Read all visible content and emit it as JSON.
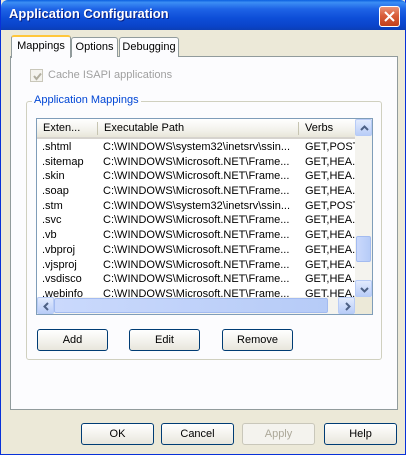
{
  "window": {
    "title": "Application Configuration"
  },
  "tabs": [
    {
      "label": "Mappings",
      "active": true
    },
    {
      "label": "Options",
      "active": false
    },
    {
      "label": "Debugging",
      "active": false
    }
  ],
  "cache_isapi": {
    "label": "Cache ISAPI applications",
    "checked": true,
    "enabled": false
  },
  "group": {
    "label": "Application Mappings"
  },
  "list": {
    "columns": [
      "Exten...",
      "Executable Path",
      "Verbs"
    ],
    "rows": [
      [
        ".shtml",
        "C:\\WINDOWS\\system32\\inetsrv\\ssin...",
        "GET,POST"
      ],
      [
        ".sitemap",
        "C:\\WINDOWS\\Microsoft.NET\\Frame...",
        "GET,HEA..."
      ],
      [
        ".skin",
        "C:\\WINDOWS\\Microsoft.NET\\Frame...",
        "GET,HEA..."
      ],
      [
        ".soap",
        "C:\\WINDOWS\\Microsoft.NET\\Frame...",
        "GET,HEA..."
      ],
      [
        ".stm",
        "C:\\WINDOWS\\system32\\inetsrv\\ssin...",
        "GET,POST"
      ],
      [
        ".svc",
        "C:\\WINDOWS\\Microsoft.NET\\Frame...",
        "GET,HEA..."
      ],
      [
        ".vb",
        "C:\\WINDOWS\\Microsoft.NET\\Frame...",
        "GET,HEA..."
      ],
      [
        ".vbproj",
        "C:\\WINDOWS\\Microsoft.NET\\Frame...",
        "GET,HEA..."
      ],
      [
        ".vjsproj",
        "C:\\WINDOWS\\Microsoft.NET\\Frame...",
        "GET,HEA..."
      ],
      [
        ".vsdisco",
        "C:\\WINDOWS\\Microsoft.NET\\Frame...",
        "GET,HEA..."
      ],
      [
        ".webinfo",
        "C:\\WINDOWS\\Microsoft.NET\\Frame...",
        "GET,HEA..."
      ]
    ],
    "vertical_scroll_position": 0.85,
    "horizontal_scroll_position": 0.0
  },
  "mapping_buttons": {
    "add": "Add",
    "edit": "Edit",
    "remove": "Remove"
  },
  "dialog_buttons": {
    "ok": "OK",
    "cancel": "Cancel",
    "apply": "Apply",
    "help": "Help"
  },
  "colors": {
    "titlebar": "#0a5fe0",
    "group_label": "#0046d5",
    "active_tab_accent": "#ffc73c",
    "close_button": "#d95d3a"
  },
  "icons": {
    "close": "close-icon",
    "check": "check-icon",
    "scroll_up": "arrow-up-icon",
    "scroll_down": "arrow-down-icon",
    "scroll_left": "arrow-left-icon",
    "scroll_right": "arrow-right-icon"
  }
}
